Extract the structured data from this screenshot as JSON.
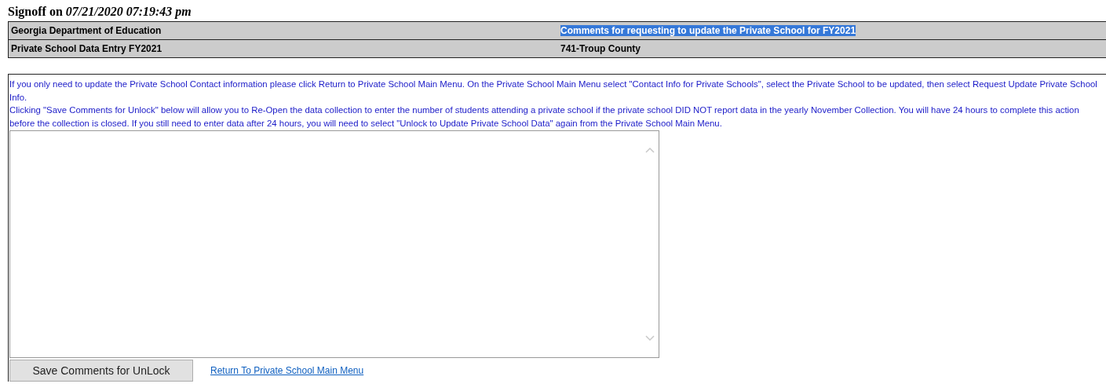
{
  "heading": {
    "label": "Signoff on",
    "timestamp": "07/21/2020 07:19:43 pm"
  },
  "header_table": {
    "rows": [
      {
        "cells": [
          {
            "text": "Georgia Department of Education",
            "highlighted": false
          },
          {
            "text": "Comments for requesting to update the Private School for FY2021",
            "highlighted": true
          }
        ]
      },
      {
        "cells": [
          {
            "text": "Private School Data Entry FY2021",
            "highlighted": false
          },
          {
            "text": "741-Troup County",
            "highlighted": false
          }
        ]
      }
    ]
  },
  "instructions": [
    "If you only need to update the Private School Contact information please click Return to Private School Main Menu. On the Private School Main Menu select \"Contact Info for Private Schools\", select the Private School to be updated, then select Request Update Private School Info.",
    "Clicking \"Save Comments for Unlock\" below will allow you to Re-Open the data collection to enter the number of students attending a private school if the private school DID NOT report data in the yearly November Collection. You will have 24 hours to complete this action before the collection is closed. If you still need to enter data after 24 hours, you will need to select \"Unlock to Update Private School Data\" again from the Private School Main Menu."
  ],
  "save_button": "Save Comments for UnLock",
  "return_link": "Return To Private School Main Menu"
}
